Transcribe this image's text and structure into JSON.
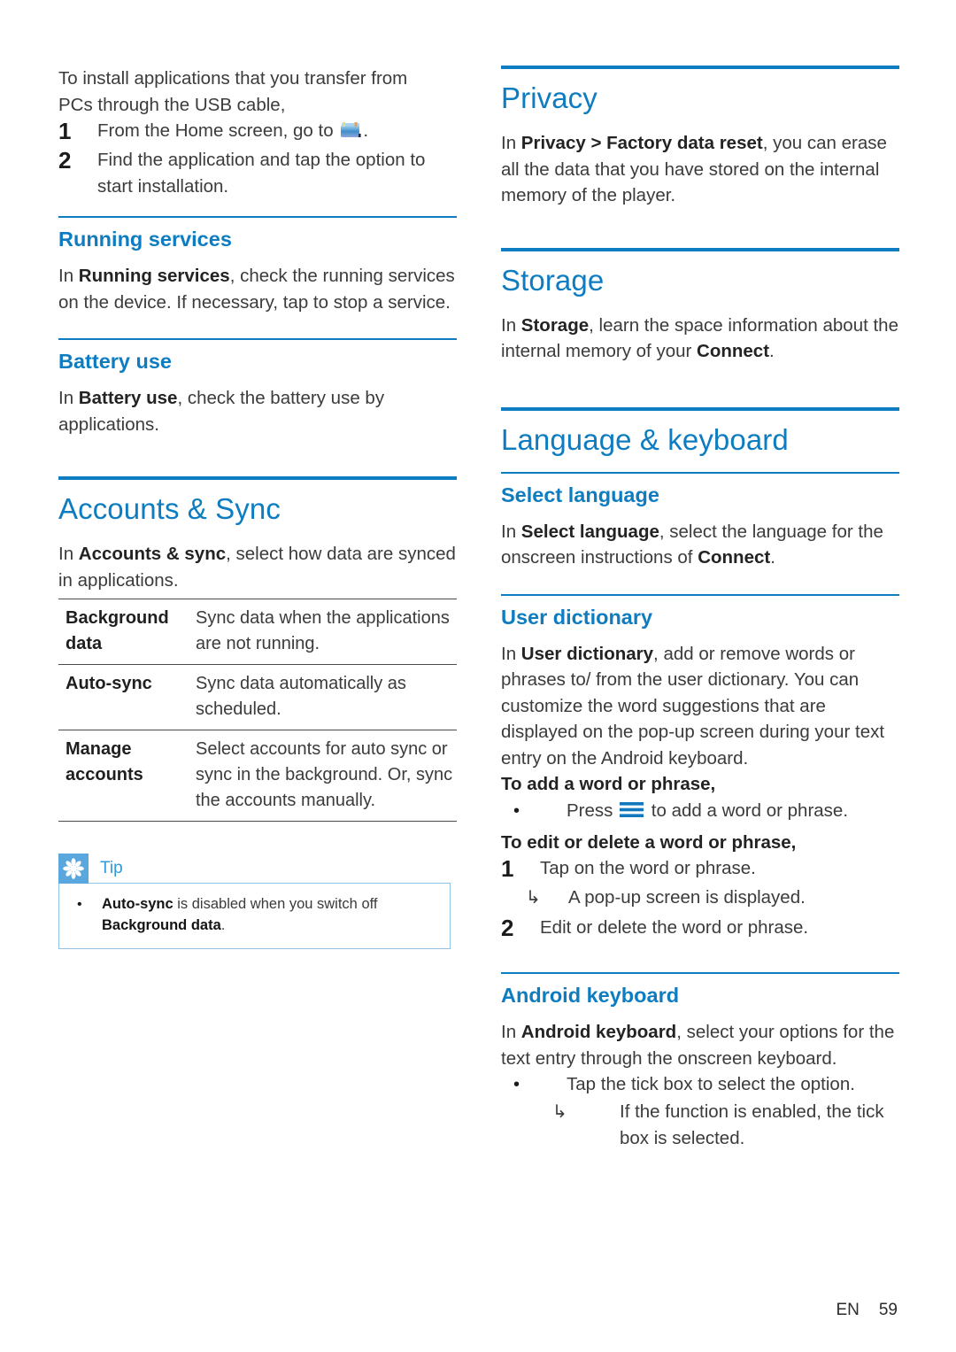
{
  "page": {
    "footer_lang": "EN",
    "footer_number": "59",
    "accent_blue": "#0d7cc0",
    "tip_blue": "#5aa7dd",
    "body_gray": "#3b3b3b"
  },
  "left_column": {
    "intro": {
      "lead_line1": "To install applications that you transfer from",
      "lead_line2": "PCs through the USB cable,",
      "steps": [
        {
          "num": "1",
          "text_before": "From the Home screen, go to ",
          "icon": "explorer-icon",
          "text_after": "."
        },
        {
          "num": "2",
          "text_before": "Find the application and tap the option to start installation.",
          "icon": "",
          "text_after": ""
        }
      ]
    },
    "running_services": {
      "heading": "Running services",
      "body_plain_1": "In ",
      "body_bold_1": "Running services",
      "body_plain_2": ", check the running services on the device. If necessary, tap to stop a service."
    },
    "battery_use": {
      "heading": "Battery use",
      "body_plain_1": "In ",
      "body_bold_1": "Battery use",
      "body_plain_2": ", check the battery use by applications."
    },
    "accounts_sync": {
      "heading": "Accounts & Sync",
      "body_plain_1": "In ",
      "body_bold_1": "Accounts & sync",
      "body_plain_2": ", select how data are synced in applications.",
      "table_rows": [
        {
          "key": "Background data",
          "value": "Sync data when the applications are not running."
        },
        {
          "key": "Auto-sync",
          "value": "Sync data automatically as scheduled."
        },
        {
          "key": "Manage accounts",
          "value": "Select accounts for auto sync or sync in the background. Or, sync the accounts manually."
        }
      ],
      "tip": {
        "icon_name": "tip-asterisk-icon",
        "label": "Tip",
        "bullet": "•",
        "text_bold_1": "Auto-sync",
        "text_plain_1": " is disabled when you switch off ",
        "text_bold_2": "Background data",
        "text_plain_2": "."
      }
    }
  },
  "right_column": {
    "privacy": {
      "heading": "Privacy",
      "body_plain_1": "In ",
      "body_bold_1": "Privacy > Factory data reset",
      "body_plain_2": ", you can erase all the data that you have stored on the internal memory of the player."
    },
    "storage": {
      "heading": "Storage",
      "body_plain_1": "In ",
      "body_bold_1": "Storage",
      "body_plain_2": ", learn the space information about the internal memory of your ",
      "body_bold_2": "Connect",
      "body_plain_3": "."
    },
    "language_keyboard": {
      "heading": "Language & keyboard",
      "select_language": {
        "heading": "Select language",
        "body_plain_1": "In ",
        "body_bold_1": "Select language",
        "body_plain_2": ", select the language for the onscreen instructions of ",
        "body_bold_2": "Connect",
        "body_plain_3": "."
      },
      "user_dictionary": {
        "heading": "User dictionary",
        "body_plain_1": "In ",
        "body_bold_1": "User dictionary",
        "body_plain_2": ", add or remove words or phrases to/ from the user dictionary. You can customize the word suggestions that are displayed on the pop-up screen during your text entry on the Android keyboard.",
        "add_heading": "To add a word or phrase,",
        "add_bullet": "•",
        "add_text_before": "Press ",
        "add_icon": "menu-icon",
        "add_text_after": " to add a word or phrase.",
        "edit_heading": "To edit or delete a word or phrase,",
        "edit_steps": [
          {
            "num": "1",
            "text": "Tap on the word or phrase."
          },
          {
            "num": "2",
            "text": "Edit or delete the word or phrase."
          }
        ],
        "edit_substep_arrow": "↳",
        "edit_substep_text": "A pop-up screen is displayed."
      },
      "android_keyboard": {
        "heading": "Android keyboard",
        "body_plain_1": "In ",
        "body_bold_1": "Android keyboard",
        "body_plain_2": ", select your options for the text entry through the onscreen keyboard.",
        "bullet": "•",
        "bullet_text": "Tap the tick box to select the option.",
        "arrow": "↳",
        "arrow_text": "If the function is enabled, the tick box is selected."
      }
    }
  }
}
